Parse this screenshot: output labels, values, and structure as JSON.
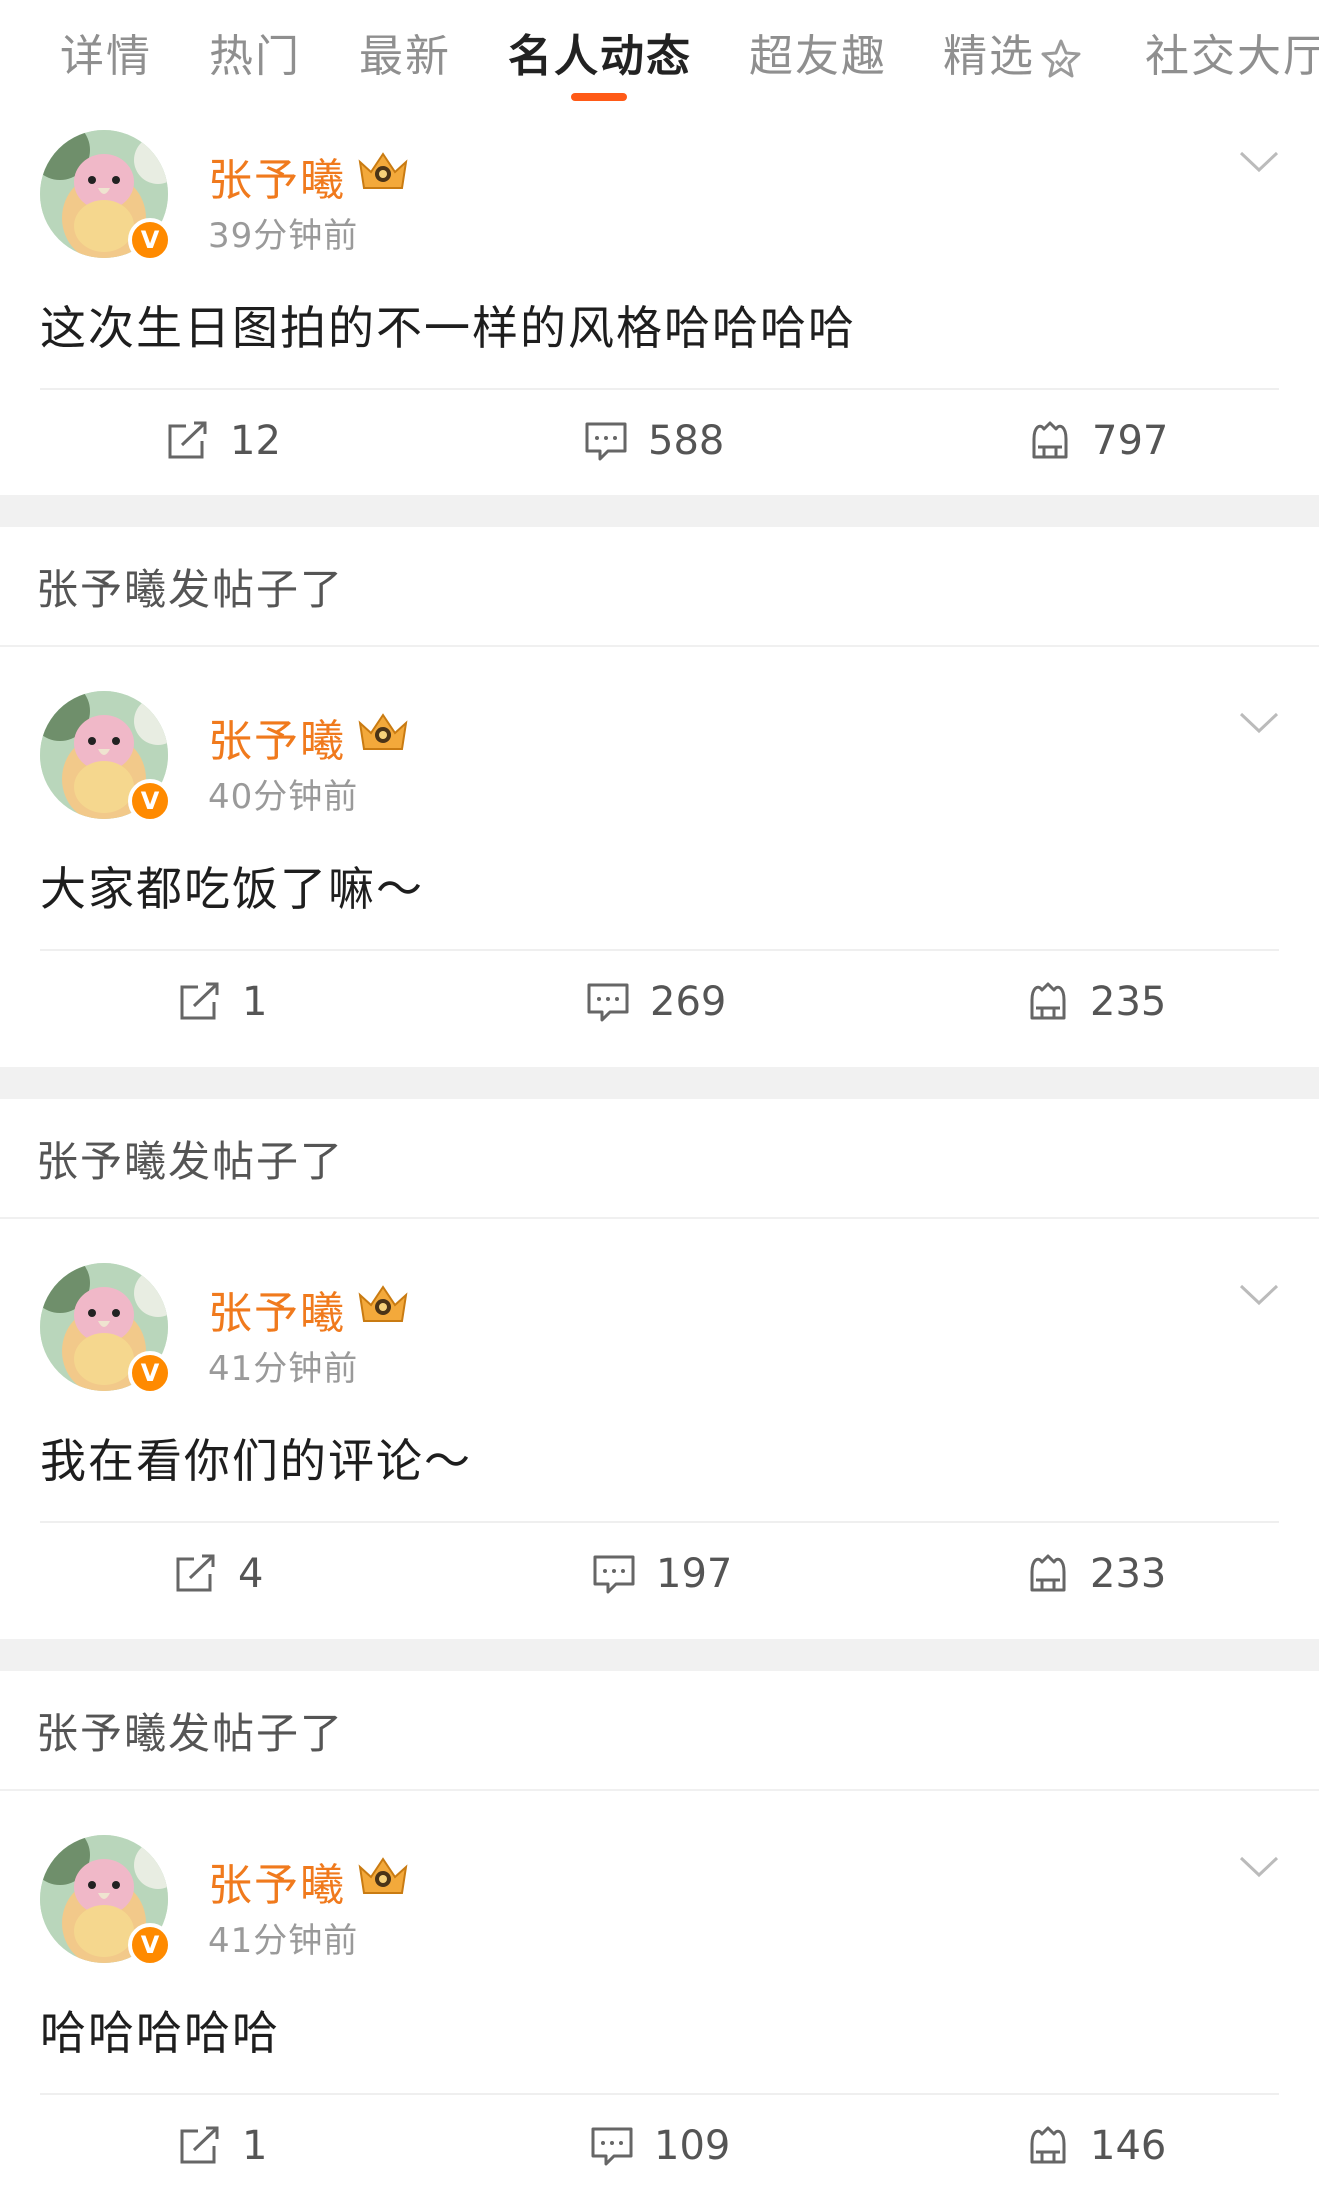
{
  "tabs": [
    {
      "label": "详情"
    },
    {
      "label": "热门"
    },
    {
      "label": "最新"
    },
    {
      "label": "名人动态",
      "active": true
    },
    {
      "label": "超友趣"
    },
    {
      "label": "精选"
    },
    {
      "label": "社交大厅"
    }
  ],
  "posts": [
    {
      "header": "",
      "name": "张予曦",
      "time": "39分钟前",
      "content": "这次生日图拍的不一样的风格哈哈哈哈",
      "repost": "12",
      "comments": "588",
      "likes": "797"
    },
    {
      "header": "张予曦发帖子了",
      "name": "张予曦",
      "time": "40分钟前",
      "content": "大家都吃饭了嘛～",
      "repost": "1",
      "comments": "269",
      "likes": "235"
    },
    {
      "header": "张予曦发帖子了",
      "name": "张予曦",
      "time": "41分钟前",
      "content": "我在看你们的评论～",
      "repost": "4",
      "comments": "197",
      "likes": "233"
    },
    {
      "header": "张予曦发帖子了",
      "name": "张予曦",
      "time": "41分钟前",
      "content": "哈哈哈哈哈",
      "repost": "1",
      "comments": "109",
      "likes": "146"
    }
  ],
  "icons": {
    "repost": "repost-icon",
    "comment": "comment-icon",
    "like": "like-icon",
    "verified": "verified-v-icon",
    "member": "crown-icon",
    "menu": "chevron-down-icon"
  },
  "colors": {
    "accent": "#ff5a17",
    "username": "#f07a1d",
    "verified": "#ff8a00"
  }
}
